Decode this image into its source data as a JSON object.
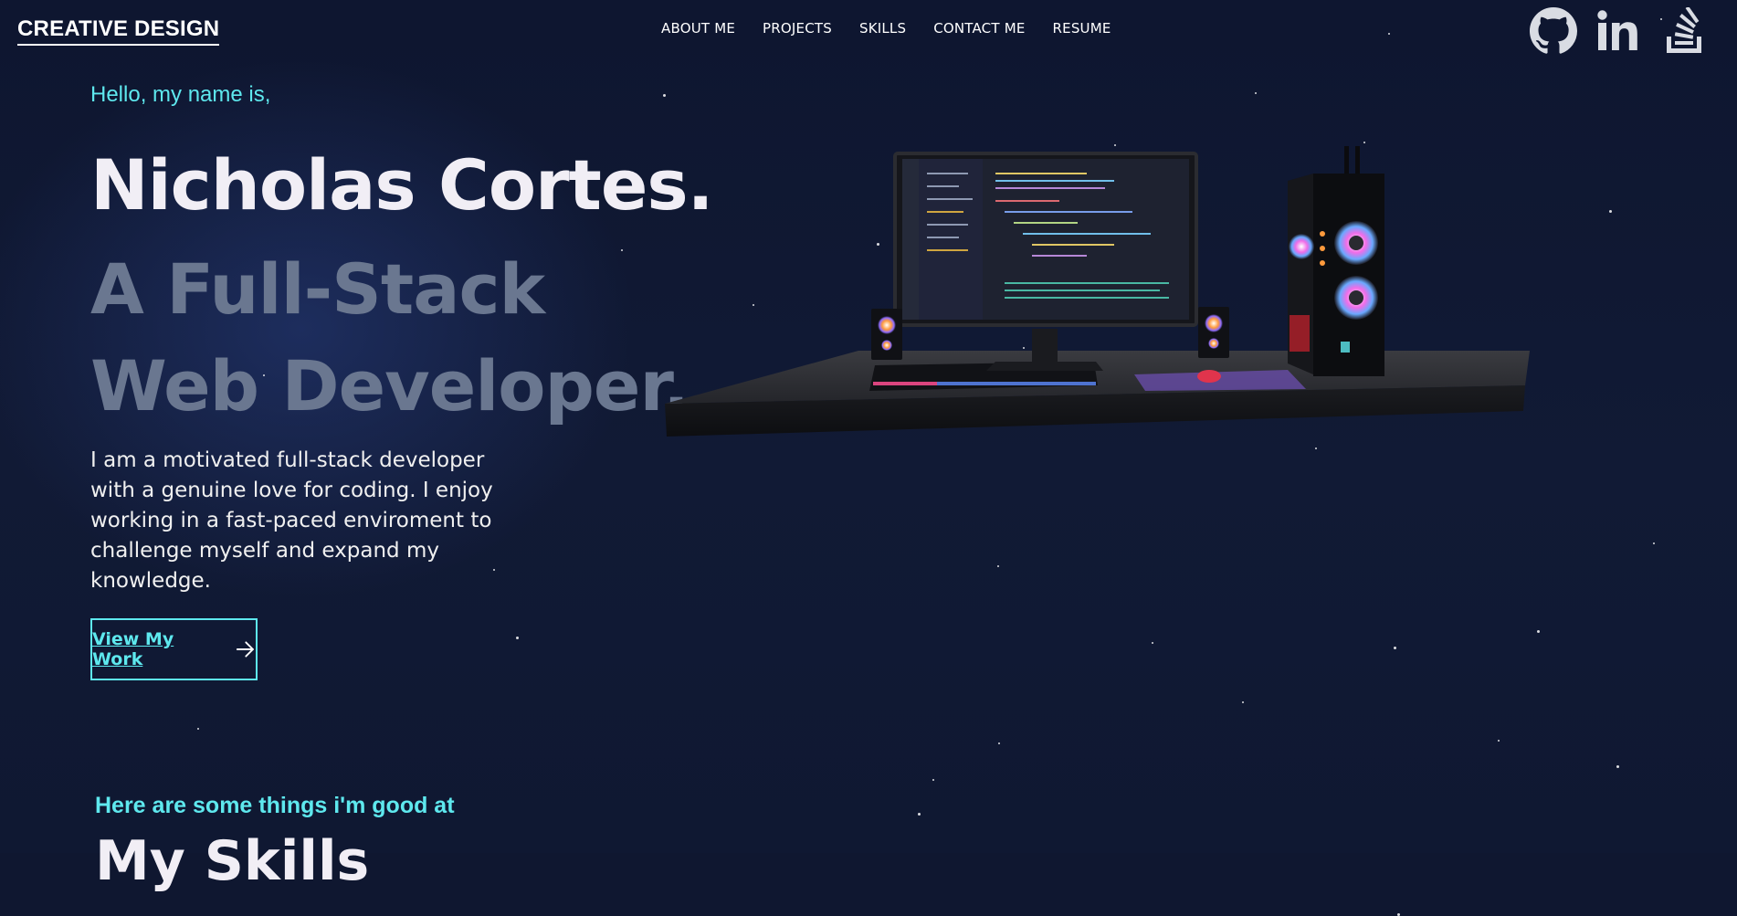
{
  "brand": {
    "logo": "CREATIVE DESIGN"
  },
  "nav": {
    "items": [
      "ABOUT ME",
      "PROJECTS",
      "SKILLS",
      "CONTACT ME",
      "RESUME"
    ]
  },
  "socials": [
    "github-icon",
    "linkedin-icon",
    "stackoverflow-icon"
  ],
  "hero": {
    "greeting": "Hello, my name is,",
    "name": "Nicholas Cortes.",
    "role_line1": "A Full-Stack",
    "role_line2": "Web Developer.",
    "intro": "I am a motivated full-stack developer with a genuine love for coding. I enjoy working in a fast-paced enviroment to challenge myself and expand my knowledge.",
    "cta_label": "View My Work"
  },
  "skills": {
    "subtitle": "Here are some things i'm good at",
    "title": "My Skills"
  },
  "colors": {
    "accent": "#5ee8ee",
    "background": "#0f1730",
    "role_text": "#6a7790"
  }
}
